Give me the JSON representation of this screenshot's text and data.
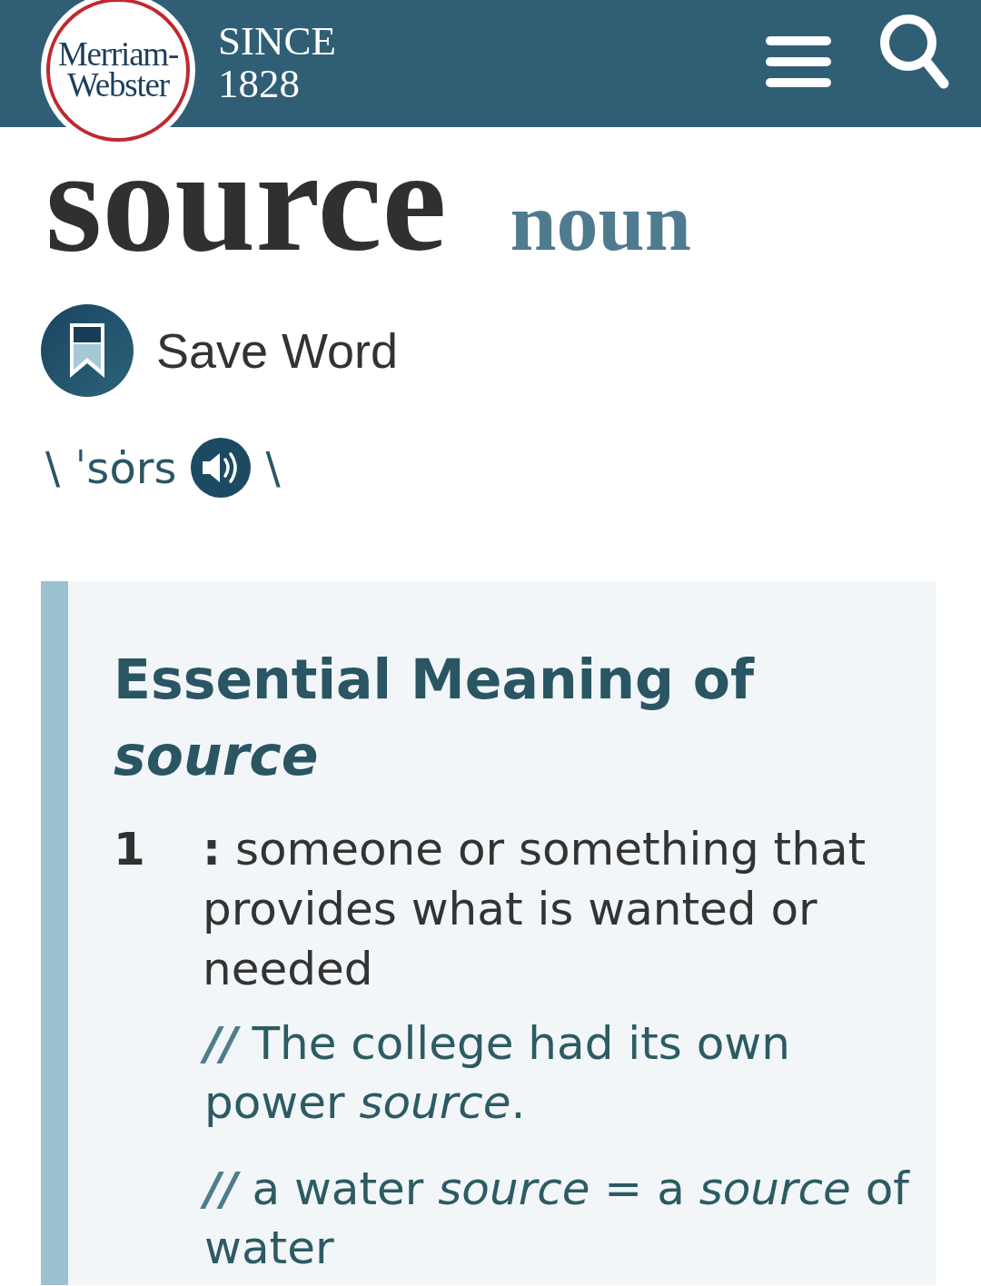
{
  "header": {
    "logo": {
      "line_1": "Merriam-",
      "line_2": "Webster"
    },
    "tagline": {
      "since": "SINCE",
      "year": "1828"
    }
  },
  "entry": {
    "headword": "source",
    "part_of_speech": "noun",
    "save_button": {
      "label": "Save Word"
    },
    "pronunciation": {
      "open_mark": "\\",
      "respelling": "ˈsȯrs",
      "close_mark": "\\"
    }
  },
  "essential_meaning": {
    "title": "Essential Meaning of *source*",
    "senses": [
      {
        "number": "1",
        "definition": "**:** someone or something that provides what is wanted or needed",
        "examples": [
          {
            "marker": "//",
            "text": "The college had its own power *source*."
          },
          {
            "marker": "//",
            "text": "a water *source* = a *source* of water"
          }
        ]
      }
    ]
  }
}
